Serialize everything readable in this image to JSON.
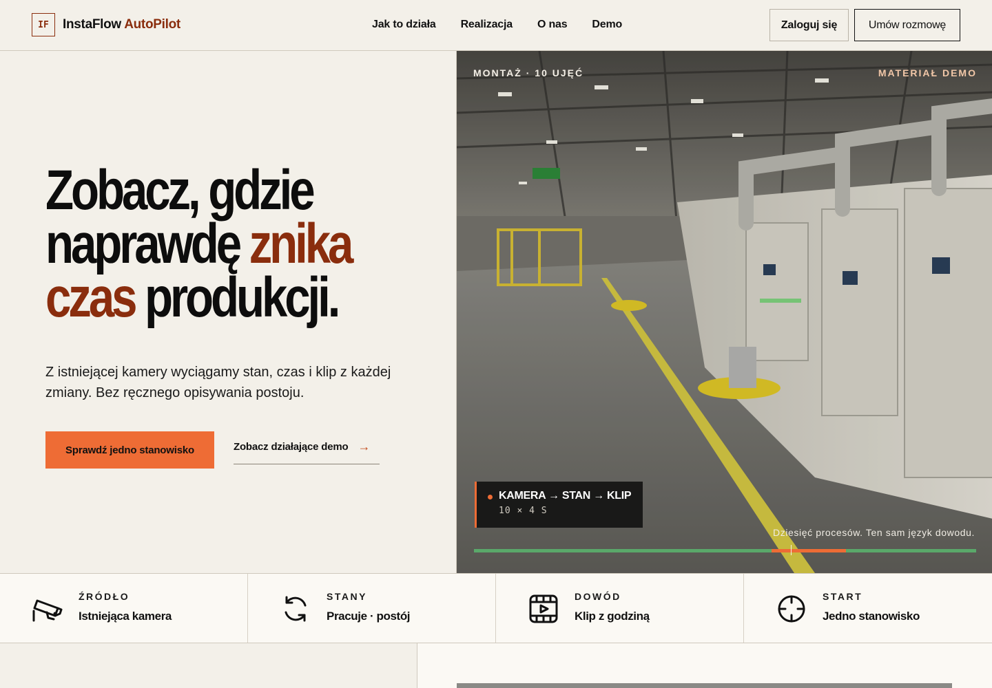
{
  "header": {
    "logo_mark": "IF",
    "brand_primary": "InstaFlow",
    "brand_accent": "AutoPilot",
    "nav": [
      {
        "label": "Jak to działa"
      },
      {
        "label": "Realizacja"
      },
      {
        "label": "O nas"
      },
      {
        "label": "Demo"
      }
    ],
    "login_label": "Zaloguj się",
    "meeting_label": "Umów rozmowę"
  },
  "hero": {
    "title_line1": "Zobacz, gdzie",
    "title_line2_plain": "naprawdę ",
    "title_line2_accent": "znika",
    "title_line3_accent": "czas",
    "title_line3_plain": " produkcji.",
    "subtitle": "Z istniejącej kamery wyciągamy stan, czas i klip z każdej zmiany. Bez ręcznego opisywania postoju.",
    "primary_cta": "Sprawdź jedno stanowisko",
    "secondary_cta": "Zobacz działające demo",
    "secondary_cta_arrow": "→"
  },
  "media": {
    "tag_left": "MONTAŻ · 10 UJĘĆ",
    "tag_right": "MATERIAŁ DEMO",
    "pipeline_title": "KAMERA → STAN → KLIP",
    "pipeline_meta": "10 × 4 S",
    "caption": "Dziesięć procesów. Ten sam język dowodu.",
    "timeline": {
      "highlight_start": 0.593,
      "highlight_end": 0.741,
      "cursor": 0.631
    }
  },
  "features": [
    {
      "label": "ŹRÓDŁO",
      "value": "Istniejąca kamera",
      "icon": "cctv-camera-icon"
    },
    {
      "label": "STANY",
      "value": "Pracuje · postój",
      "icon": "refresh-cycle-icon"
    },
    {
      "label": "DOWÓD",
      "value": "Klip z godziną",
      "icon": "video-clip-icon"
    },
    {
      "label": "START",
      "value": "Jedno stanowisko",
      "icon": "target-crosshair-icon"
    }
  ],
  "colors": {
    "accent_brown": "#8a2d0d",
    "accent_orange": "#ee6c35",
    "background": "#f3f0e9",
    "timeline_green": "#5aa86a"
  }
}
